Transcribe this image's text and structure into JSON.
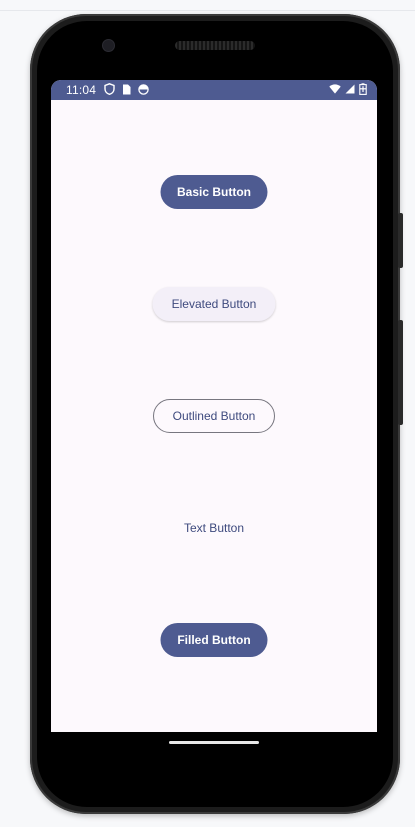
{
  "status_bar": {
    "time": "11:04",
    "left_icons": [
      "shield-icon",
      "sim-card-icon",
      "circle-half-icon"
    ],
    "right_icons": [
      "wifi-icon",
      "cell-signal-icon",
      "battery-icon"
    ],
    "background": "#4e5b91"
  },
  "buttons": {
    "basic": "Basic Button",
    "elevated": "Elevated Button",
    "outlined": "Outlined Button",
    "text": "Text Button",
    "filled": "Filled Button"
  },
  "colors": {
    "primary": "#4e5b91",
    "on_primary": "#ffffff",
    "surface": "#fdf9fd",
    "elevated_container": "#f3eff8",
    "outline": "#77767f"
  }
}
